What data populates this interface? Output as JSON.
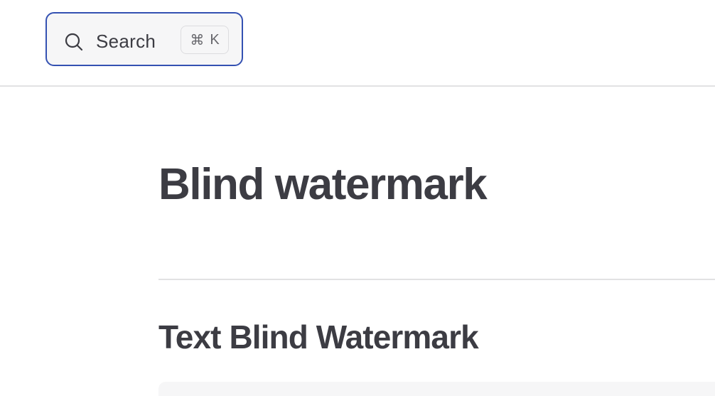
{
  "search": {
    "label": "Search",
    "shortcut_symbol": "⌘",
    "shortcut_key": "K",
    "accent_color": "#3451b2"
  },
  "main": {
    "title": "Blind watermark",
    "section_heading": "Text Blind Watermark"
  },
  "icons": {
    "search": "search-icon"
  },
  "colors": {
    "text": "#3c3c43",
    "divider": "#e2e2e3",
    "surface": "#f6f6f7"
  }
}
